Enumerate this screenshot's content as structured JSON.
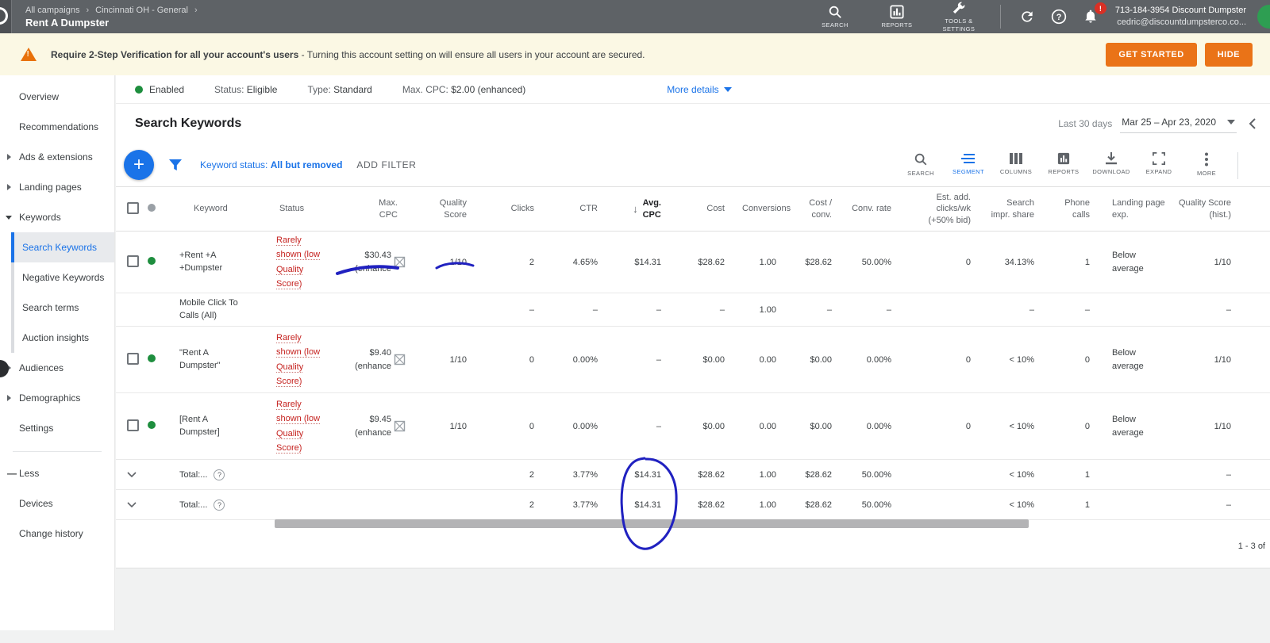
{
  "topbar": {
    "breadcrumb_1": "All campaigns",
    "breadcrumb_2": "Cincinnati OH - General",
    "page_title": "Rent A Dumpster",
    "search_label": "SEARCH",
    "reports_label": "REPORTS",
    "tools_label": "TOOLS & SETTINGS",
    "account_name": "713-184-3954 Discount Dumpster",
    "account_email": "cedric@discountdumpsterco.co...",
    "notification_badge": "!"
  },
  "glyphs": {
    "chevron_sep": "›",
    "plus": "+",
    "question": "?",
    "less_dash": "—"
  },
  "banner": {
    "bold_text": "Require 2-Step Verification for all your account's users",
    "rest_text": " - Turning this account setting on will ensure all users in your account are secured.",
    "get_started_label": "GET STARTED",
    "hide_label": "HIDE"
  },
  "sidebar": {
    "overview": "Overview",
    "recommendations": "Recommendations",
    "ads_extensions": "Ads & extensions",
    "landing_pages": "Landing pages",
    "keywords": "Keywords",
    "search_keywords": "Search Keywords",
    "negative_keywords": "Negative Keywords",
    "search_terms": "Search terms",
    "auction_insights": "Auction insights",
    "audiences": "Audiences",
    "demographics": "Demographics",
    "settings": "Settings",
    "less": "Less",
    "devices": "Devices",
    "change_history": "Change history"
  },
  "statusbar": {
    "enabled": "Enabled",
    "status_label": "Status:",
    "status_value": "Eligible",
    "type_label": "Type:",
    "type_value": "Standard",
    "maxcpc_label": "Max. CPC:",
    "maxcpc_value": "$2.00 (enhanced)",
    "more_details": "More details"
  },
  "header": {
    "title": "Search Keywords",
    "range_preset": "Last 30 days",
    "range_dates": "Mar 25 – Apr 23, 2020"
  },
  "filterbar": {
    "keyword_status_label": "Keyword status:",
    "keyword_status_value": "All but removed",
    "add_filter": "ADD FILTER",
    "tool_search": "SEARCH",
    "tool_segment": "SEGMENT",
    "tool_columns": "COLUMNS",
    "tool_reports": "REPORTS",
    "tool_download": "DOWNLOAD",
    "tool_expand": "EXPAND",
    "tool_more": "MORE"
  },
  "table": {
    "headers": {
      "keyword": "Keyword",
      "status": "Status",
      "max_cpc": "Max.\nCPC",
      "quality_score": "Quality Score",
      "clicks": "Clicks",
      "ctr": "CTR",
      "sort_arrow": "↓",
      "avg_cpc": "Avg.\nCPC",
      "cost": "Cost",
      "conversions": "Conversions",
      "cost_conv": "Cost /\nconv.",
      "conv_rate": "Conv. rate",
      "est_add": "Est. add.\nclicks/wk\n(+50% bid)",
      "impr_share": "Search\nimpr. share",
      "phone_calls": "Phone calls",
      "landing": "Landing page\nexp.",
      "qs_hist": "Quality Score\n(hist.)"
    },
    "rows": [
      {
        "keyword": "+Rent +A +Dumpster",
        "status": "Rarely shown (low Quality Score)",
        "max_cpc": "$30.43",
        "max_cpc_suffix": "(enhance",
        "qs": "1/10",
        "clicks": "2",
        "ctr": "4.65%",
        "avg_cpc": "$14.31",
        "cost": "$28.62",
        "conv": "1.00",
        "cost_conv": "$28.62",
        "conv_rate": "50.00%",
        "est_add": "0",
        "impr_share": "34.13%",
        "phone": "1",
        "landing": "Below average",
        "qs_hist": "1/10"
      },
      {
        "keyword": "Mobile Click To Calls (All)",
        "clicks": "–",
        "ctr": "–",
        "avg_cpc": "–",
        "cost": "–",
        "conv": "1.00",
        "cost_conv": "–",
        "conv_rate": "–",
        "impr_share": "–",
        "phone": "–",
        "qs_hist": "–"
      },
      {
        "keyword": "\"Rent A Dumpster\"",
        "status": "Rarely shown (low Quality Score)",
        "max_cpc": "$9.40",
        "max_cpc_suffix": "(enhance",
        "qs": "1/10",
        "clicks": "0",
        "ctr": "0.00%",
        "avg_cpc": "–",
        "cost": "$0.00",
        "conv": "0.00",
        "cost_conv": "$0.00",
        "conv_rate": "0.00%",
        "est_add": "0",
        "impr_share": "< 10%",
        "phone": "0",
        "landing": "Below average",
        "qs_hist": "1/10"
      },
      {
        "keyword": "[Rent A Dumpster]",
        "status": "Rarely shown (low Quality Score)",
        "max_cpc": "$9.45",
        "max_cpc_suffix": "(enhance",
        "qs": "1/10",
        "clicks": "0",
        "ctr": "0.00%",
        "avg_cpc": "–",
        "cost": "$0.00",
        "conv": "0.00",
        "cost_conv": "$0.00",
        "conv_rate": "0.00%",
        "est_add": "0",
        "impr_share": "< 10%",
        "phone": "0",
        "landing": "Below average",
        "qs_hist": "1/10"
      }
    ],
    "totals": [
      {
        "label": "Total:...",
        "clicks": "2",
        "ctr": "3.77%",
        "avg_cpc": "$14.31",
        "cost": "$28.62",
        "conv": "1.00",
        "cost_conv": "$28.62",
        "conv_rate": "50.00%",
        "impr_share": "< 10%",
        "phone": "1",
        "qs_hist": "–"
      },
      {
        "label": "Total:...",
        "clicks": "2",
        "ctr": "3.77%",
        "avg_cpc": "$14.31",
        "cost": "$28.62",
        "conv": "1.00",
        "cost_conv": "$28.62",
        "conv_rate": "50.00%",
        "impr_share": "< 10%",
        "phone": "1",
        "qs_hist": "–"
      }
    ],
    "pagination": "1 - 3 of"
  },
  "colors": {
    "accent": "#1a73e8",
    "warning_orange": "#ea7317",
    "status_red": "#c5221f",
    "enabled_green": "#1e8e3e",
    "pen_ink": "#2021c0"
  }
}
